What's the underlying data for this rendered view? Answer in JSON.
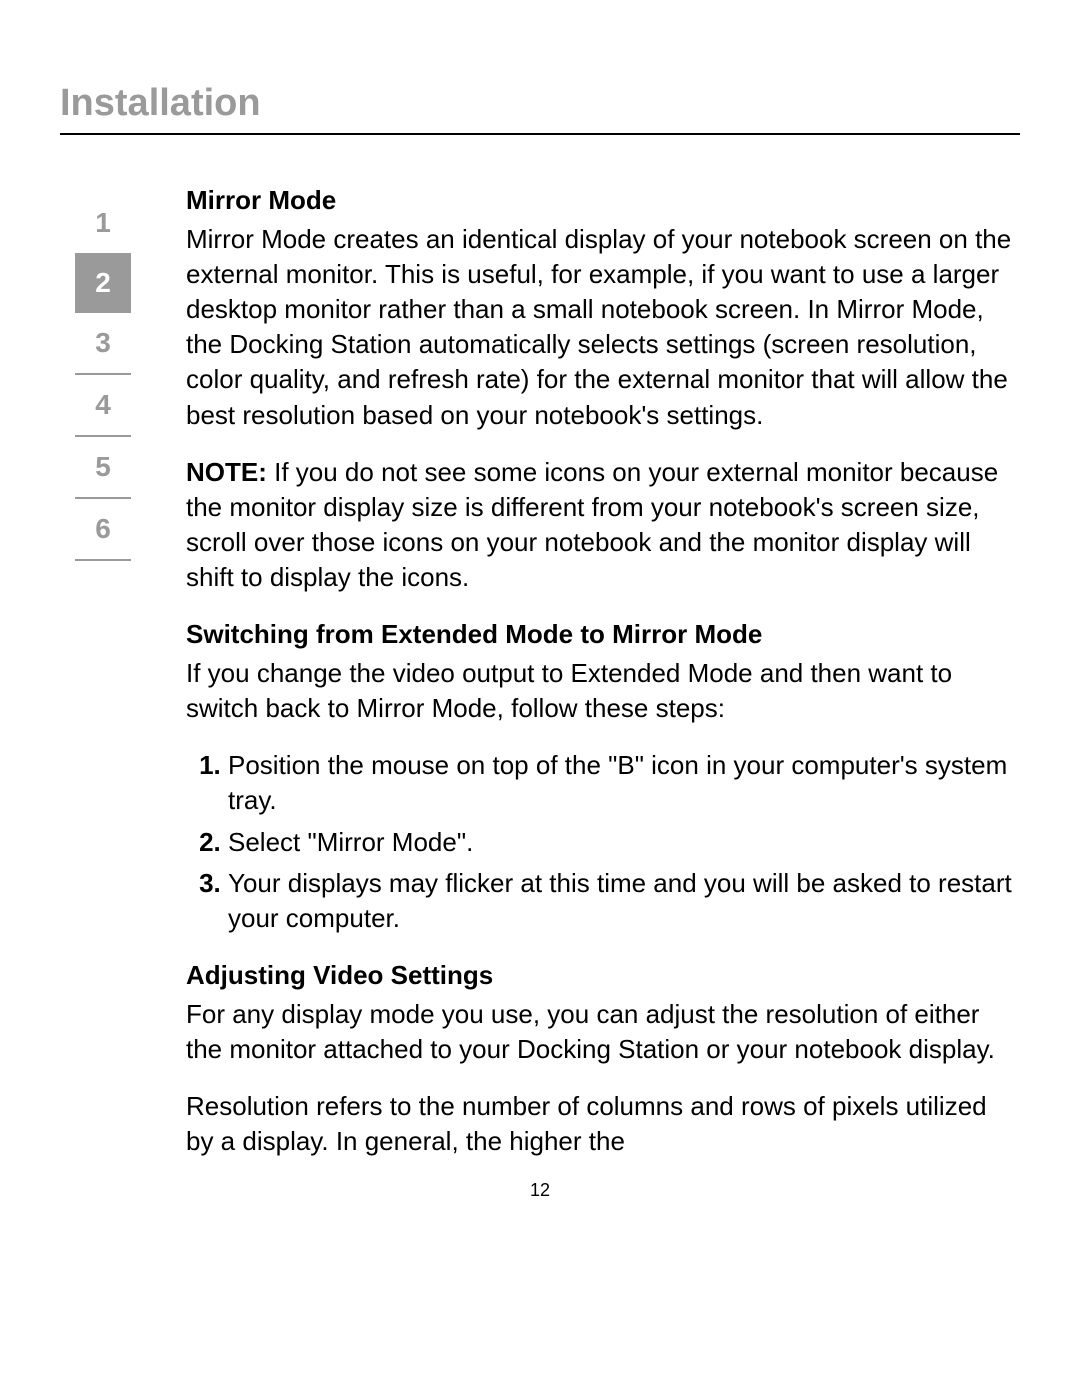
{
  "chapter_title": "Installation",
  "page_number": "12",
  "nav": {
    "items": [
      "1",
      "2",
      "3",
      "4",
      "5",
      "6"
    ],
    "active_index": 1
  },
  "sections": {
    "mirror": {
      "heading": "Mirror Mode",
      "body": "Mirror Mode creates an identical display of your notebook screen on the external monitor. This is useful, for example, if you want to use a larger desktop monitor rather than a small notebook screen. In Mirror Mode, the Docking Station automatically selects settings (screen resolution, color quality, and refresh rate) for the external monitor that will allow the best resolution based on your notebook's settings.",
      "note_label": "NOTE:",
      "note_body": " If you do not see some icons on your external monitor because the monitor display size is different from your notebook's screen size, scroll over those icons on your notebook and the monitor display will shift to display the icons."
    },
    "switching": {
      "heading": "Switching from Extended Mode to Mirror Mode",
      "intro": "If you change the video output to Extended Mode and then want to switch back to Mirror Mode, follow these steps:",
      "steps": [
        "Position the mouse on top of the \"B\" icon in your computer's system tray.",
        "Select \"Mirror Mode\".",
        "Your displays may flicker at this time and you will be asked to restart your computer."
      ]
    },
    "adjusting": {
      "heading": "Adjusting Video Settings",
      "p1": "For any display mode you use, you can adjust the resolution of either the monitor attached to your Docking Station or your notebook display.",
      "p2": "Resolution refers to the number of columns and rows of pixels utilized by a display. In general, the higher the"
    }
  }
}
